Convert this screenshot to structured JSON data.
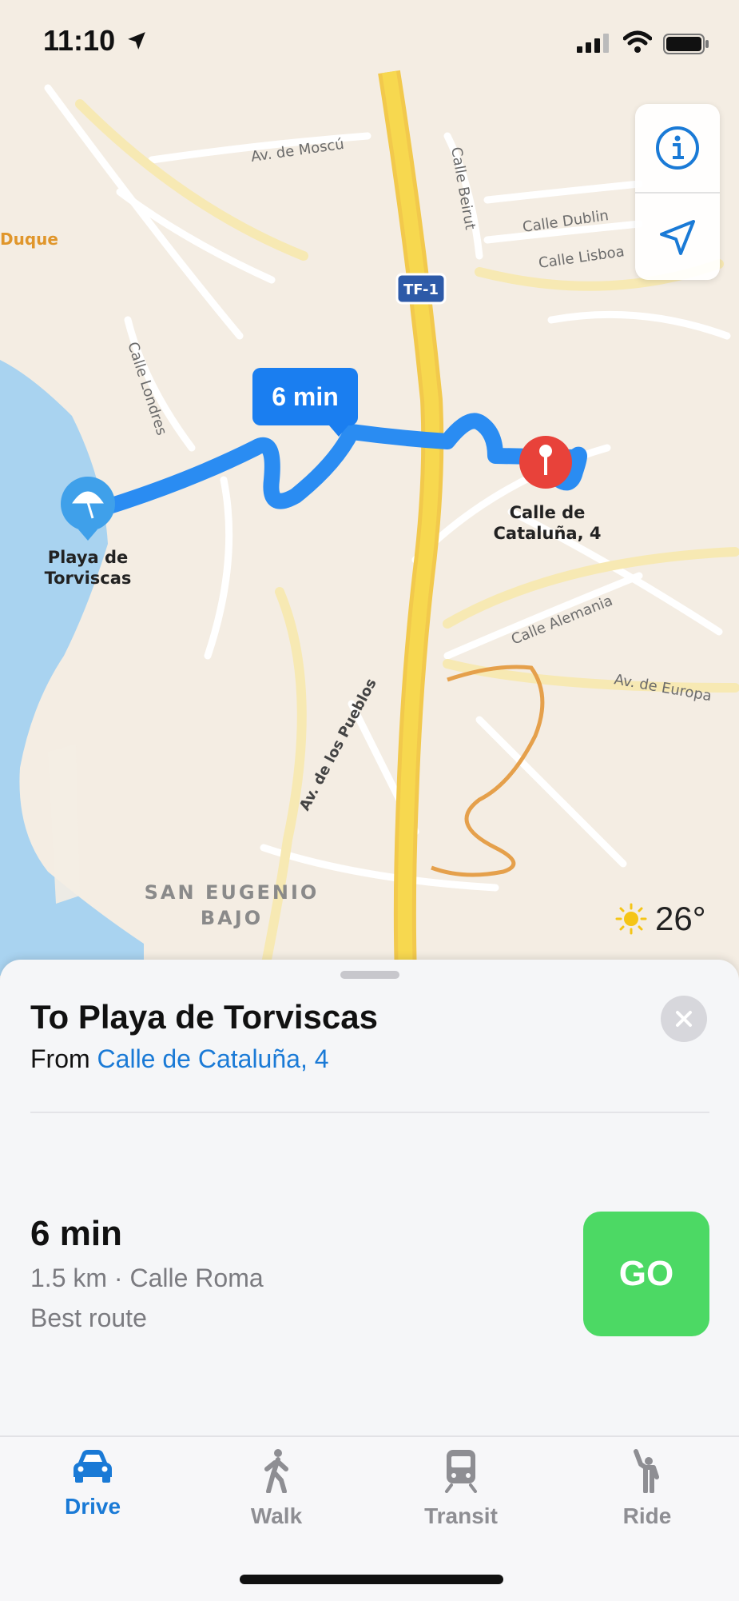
{
  "status_bar": {
    "time": "11:10"
  },
  "map": {
    "street_labels": {
      "av_moscu": "Av. de Moscú",
      "calle_beirut": "Calle Beirut",
      "calle_dublin": "Calle Dublin",
      "calle_lisboa": "Calle Lisboa",
      "calle_londres": "Calle Londres",
      "calle_alemania": "Calle Alemania",
      "av_europa": "Av. de Europa",
      "av_pueblos": "Av. de los Pueblos",
      "duque": "Duque",
      "tf1": "TF-1",
      "district_line1": "SAN EUGENIO",
      "district_line2": "BAJO"
    },
    "destination_pin": {
      "line1": "Playa de",
      "line2": "Torviscas"
    },
    "origin_pin": {
      "line1": "Calle de",
      "line2": "Cataluña, 4"
    },
    "eta_badge": "6 min",
    "weather_temp": "26°"
  },
  "sheet": {
    "title": "To Playa de Torviscas",
    "from_prefix": "From",
    "from_place": "Calle de Cataluña, 4",
    "route": {
      "time": "6 min",
      "detail": "1.5 km · Calle Roma",
      "note": "Best route",
      "go_label": "GO"
    }
  },
  "tabs": [
    {
      "label": "Drive",
      "icon": "car-icon",
      "active": true
    },
    {
      "label": "Walk",
      "icon": "walk-icon",
      "active": false
    },
    {
      "label": "Transit",
      "icon": "train-icon",
      "active": false
    },
    {
      "label": "Ride",
      "icon": "ride-icon",
      "active": false
    }
  ],
  "colors": {
    "accent": "#1a7ad6",
    "route": "#2a8cf2",
    "go_button": "#4cd964",
    "pin_red": "#e8423a",
    "highway": "#f5d34a"
  }
}
